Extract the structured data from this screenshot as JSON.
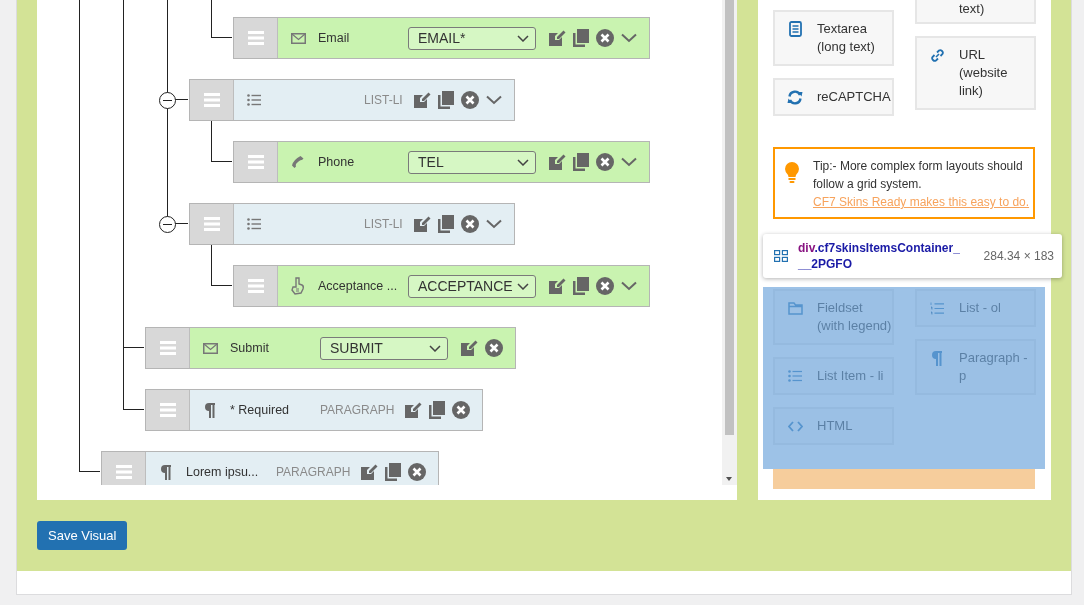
{
  "tree": [
    {
      "children": [
        {
          "children": [
            {
              "children": [
                {
                  "children": [
                    {
                      "kind": "email",
                      "label": "Email",
                      "field_type": "EMAIL*",
                      "duplicable": true,
                      "collapsible": true
                    }
                  ]
                },
                {
                  "kind": "list-item",
                  "tag": "LIST-LI",
                  "expanded": true,
                  "duplicable": true,
                  "collapsible": true,
                  "children": [
                    {
                      "kind": "tel",
                      "label": "Phone",
                      "field_type": "TEL",
                      "duplicable": true,
                      "collapsible": true
                    }
                  ]
                },
                {
                  "kind": "list-item",
                  "tag": "LIST-LI",
                  "expanded": true,
                  "duplicable": true,
                  "collapsible": true,
                  "children": [
                    {
                      "kind": "acceptance",
                      "label": "Acceptance ...",
                      "field_type": "ACCEPTANCE",
                      "duplicable": true,
                      "collapsible": true
                    }
                  ]
                }
              ]
            },
            {
              "kind": "submit",
              "label": "Submit",
              "field_type": "SUBMIT",
              "duplicable": false,
              "collapsible": false
            },
            {
              "kind": "paragraph",
              "label": "* Required",
              "tag": "PARAGRAPH",
              "duplicable": true,
              "collapsible": false
            }
          ]
        },
        {
          "kind": "paragraph",
          "label": "Lorem ipsu...",
          "tag": "PARAGRAPH",
          "duplicable": true,
          "collapsible": false
        }
      ]
    }
  ],
  "widget_columns": [
    [
      {
        "kind": "textarea",
        "label": "Textarea (long text)"
      },
      {
        "kind": "recaptcha",
        "label": "reCAPTCHA"
      }
    ],
    [
      {
        "kind": "cut",
        "label": "text)"
      },
      {
        "kind": "url",
        "label": "URL (website link)"
      }
    ]
  ],
  "tip": {
    "lead": "Tip:- More complex form layouts should follow a grid system.",
    "link": "CF7 Skins Ready makes this easy to do."
  },
  "inspector_tooltip": {
    "tag": "div",
    "class_name": ".cf7skinsItemsContainer___2PGFO",
    "size": "284.34 × 183"
  },
  "highlighted_widget_columns": [
    [
      {
        "kind": "fieldset",
        "label": "Fieldset (with legend)"
      },
      {
        "kind": "li",
        "label": "List Item - li"
      },
      {
        "kind": "html",
        "label": "HTML"
      }
    ],
    [
      {
        "kind": "ol",
        "label": "List - ol"
      },
      {
        "kind": "paragraph",
        "label": "Paragraph - p"
      }
    ]
  ],
  "save_button": "Save Visual"
}
